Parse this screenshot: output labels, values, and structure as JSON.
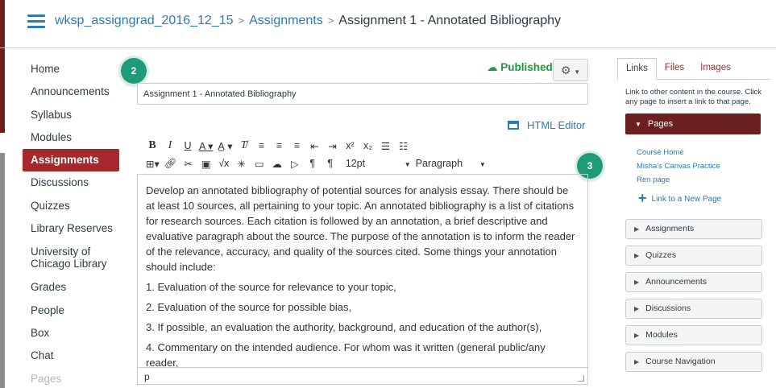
{
  "breadcrumb": {
    "course": "wksp_assigngrad_2016_12_15",
    "section": "Assignments",
    "current": "Assignment 1 - Annotated Bibliography"
  },
  "nav": {
    "items": [
      "Home",
      "Announcements",
      "Syllabus",
      "Modules",
      "Assignments",
      "Discussions",
      "Quizzes",
      "Library Reserves",
      "University of Chicago Library",
      "Grades",
      "People",
      "Box",
      "Chat",
      "Pages"
    ],
    "active": "Assignments"
  },
  "badges": {
    "b2": "2",
    "b3": "3"
  },
  "status": {
    "published": "Published"
  },
  "title_field": {
    "value": "Assignment 1 - Annotated Bibliography"
  },
  "editor": {
    "html_editor": "HTML Editor",
    "font_size": "12pt",
    "block_format": "Paragraph",
    "paragraphs": [
      "Develop an annotated bibliography of potential sources for analysis essay.  There should be at least 10 sources, all pertaining to your topic. An annotated bibliography is a list of citations for research sources. Each citation is followed by an annotation, a brief descriptive and evaluative paragraph about the source. The purpose of the annotation is to inform the reader of the relevance, accuracy, and quality of the sources cited. Some things your annotation should include:",
      "1. Evaluation of the source for relevance to your topic,",
      "2. Evaluation of the source for possible bias,",
      "3. If possible, an evaluation the authority, background, and education of the author(s),",
      "4. Commentary on the intended audience. For whom was it written (general public/any reader,"
    ],
    "status_path": "p"
  },
  "rpanel": {
    "tabs": [
      "Links",
      "Files",
      "Images"
    ],
    "help": "Link to other content in the course. Click any page to insert a link to that page.",
    "pages_header": "Pages",
    "page_links": [
      "Course Home",
      "Misha's Canvas Practice",
      "Ren page"
    ],
    "new_page": "Link to a New Page",
    "sections": [
      "Assignments",
      "Quizzes",
      "Announcements",
      "Discussions",
      "Modules",
      "Course Navigation"
    ]
  },
  "colors": {
    "brand": "#a4282c",
    "link": "#2b7abc",
    "published": "#1f9a3b",
    "badge": "#1f9a79"
  }
}
